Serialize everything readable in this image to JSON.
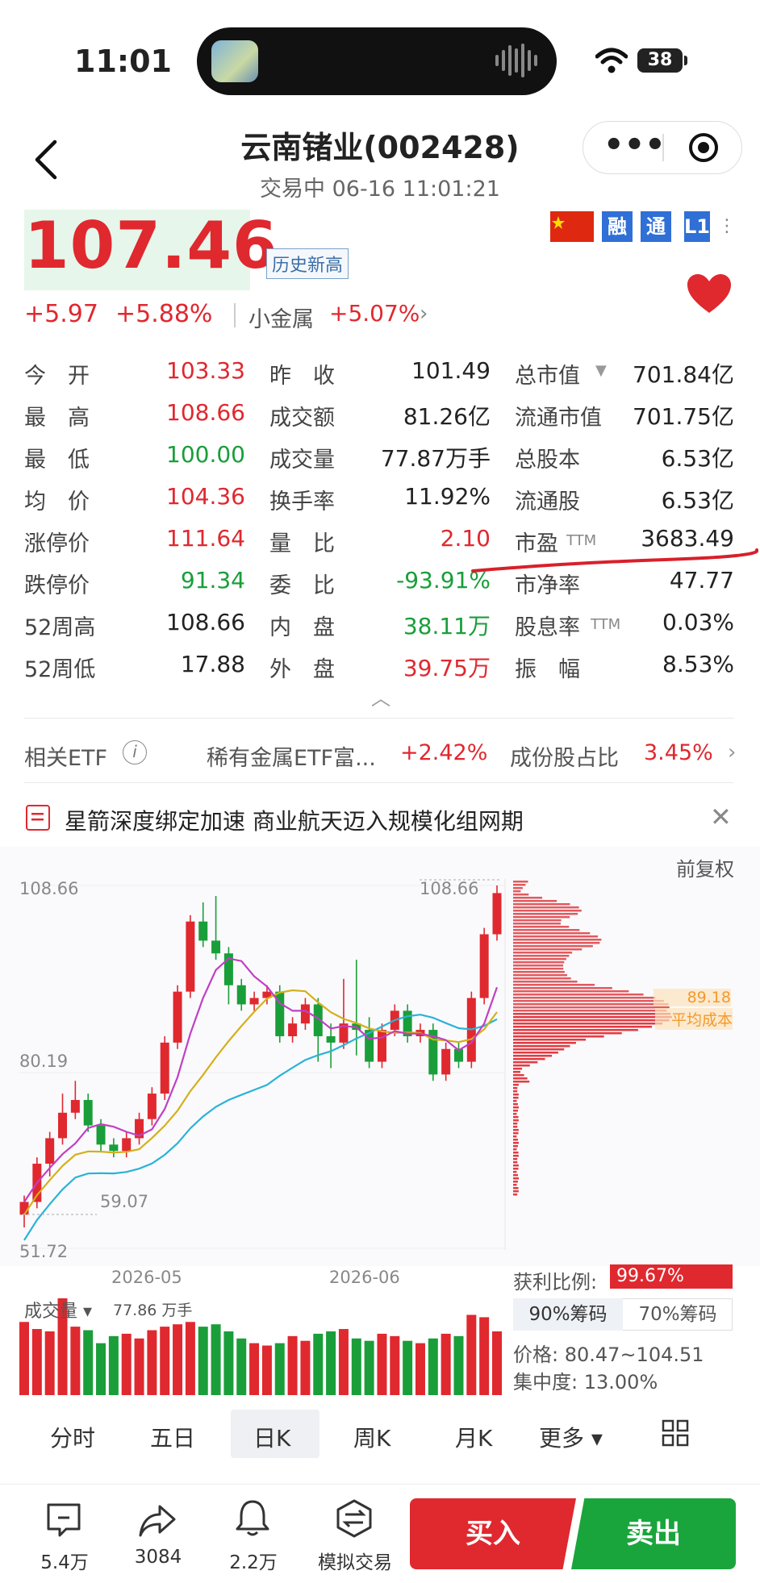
{
  "status_bar": {
    "time": "11:01",
    "battery": "38"
  },
  "header": {
    "title": "云南锗业(002428)",
    "subtitle": "交易中  06-16 11:01:21",
    "more_icon": "more-dots-icon",
    "target_icon": "target-icon"
  },
  "price": {
    "last": "107.46",
    "badge": "历史新高",
    "change": "+5.97",
    "change_pct": "+5.88%",
    "sector": "小金属",
    "sector_pct": "+5.07%",
    "tags": [
      "融",
      "通",
      "L1"
    ]
  },
  "quote": {
    "rows": [
      {
        "l1": "今　开",
        "v1": "103.33",
        "l2": "昨　收",
        "v2": "101.49",
        "l3": "总市值",
        "v3": "701.84亿"
      },
      {
        "l1": "最　高",
        "v1": "108.66",
        "l2": "成交额",
        "v2": "81.26亿",
        "l3": "流通市值",
        "v3": "701.75亿"
      },
      {
        "l1": "最　低",
        "v1": "100.00",
        "l2": "成交量",
        "v2": "77.87万手",
        "l3": "总股本",
        "v3": "6.53亿"
      },
      {
        "l1": "均　价",
        "v1": "104.36",
        "l2": "换手率",
        "v2": "11.92%",
        "l3": "流通股",
        "v3": "6.53亿"
      },
      {
        "l1": "涨停价",
        "v1": "111.64",
        "l2": "量　比",
        "v2": "2.10",
        "l3": "市盈",
        "v3": "3683.49"
      },
      {
        "l1": "跌停价",
        "v1": "91.34",
        "l2": "委　比",
        "v2": "-93.91%",
        "l3": "市净率",
        "v3": "47.77"
      },
      {
        "l1": "52周高",
        "v1": "108.66",
        "l2": "内　盘",
        "v2": "38.11万",
        "l3": "股息率",
        "v3": "0.03%"
      },
      {
        "l1": "52周低",
        "v1": "17.88",
        "l2": "外　盘",
        "v2": "39.75万",
        "l3": "振　幅",
        "v3": "8.53%"
      }
    ],
    "ttm": "TTM"
  },
  "etf": {
    "label": "相关ETF",
    "name": "稀有金属ETF富...",
    "pct": "+2.42%",
    "weight_label": "成份股占比",
    "weight": "3.45%"
  },
  "news": {
    "text": "星箭深度绑定加速 商业航天迈入规模化组网期"
  },
  "chart": {
    "adjust": "前复权",
    "y_top": "108.66",
    "y_top_right": "108.66",
    "y_mid": "80.19",
    "low_marker": "59.07",
    "y_bottom": "51.72",
    "x_labels": [
      "2026-05",
      "2026-06"
    ],
    "avg_cost_price": "89.18",
    "avg_cost_label": "平均成本"
  },
  "chart_data": {
    "type": "candlestick",
    "colors": {
      "up": "#e0282f",
      "down": "#1a9e3a",
      "ma5": "#c23fc2",
      "ma10": "#d4b01a",
      "ma20": "#2ab3d6"
    },
    "candles": [
      {
        "o": 57,
        "c": 59,
        "h": 60,
        "l": 55
      },
      {
        "o": 59,
        "c": 65,
        "h": 66,
        "l": 58
      },
      {
        "o": 65,
        "c": 69,
        "h": 70,
        "l": 63
      },
      {
        "o": 69,
        "c": 73,
        "h": 76,
        "l": 68
      },
      {
        "o": 73,
        "c": 75,
        "h": 78,
        "l": 72
      },
      {
        "o": 75,
        "c": 71,
        "h": 76,
        "l": 70
      },
      {
        "o": 71,
        "c": 68,
        "h": 72,
        "l": 67
      },
      {
        "o": 68,
        "c": 67,
        "h": 69,
        "l": 66
      },
      {
        "o": 67,
        "c": 69,
        "h": 70,
        "l": 66
      },
      {
        "o": 69,
        "c": 72,
        "h": 73,
        "l": 68
      },
      {
        "o": 72,
        "c": 76,
        "h": 77,
        "l": 71
      },
      {
        "o": 76,
        "c": 84,
        "h": 85,
        "l": 75
      },
      {
        "o": 84,
        "c": 92,
        "h": 93,
        "l": 83
      },
      {
        "o": 92,
        "c": 103,
        "h": 104,
        "l": 91
      },
      {
        "o": 103,
        "c": 100,
        "h": 106,
        "l": 99
      },
      {
        "o": 100,
        "c": 98,
        "h": 107,
        "l": 97
      },
      {
        "o": 98,
        "c": 93,
        "h": 99,
        "l": 90
      },
      {
        "o": 93,
        "c": 90,
        "h": 94,
        "l": 89
      },
      {
        "o": 90,
        "c": 91,
        "h": 92,
        "l": 89
      },
      {
        "o": 91,
        "c": 92,
        "h": 93,
        "l": 90
      },
      {
        "o": 92,
        "c": 85,
        "h": 93,
        "l": 84
      },
      {
        "o": 85,
        "c": 87,
        "h": 88,
        "l": 84
      },
      {
        "o": 87,
        "c": 90,
        "h": 91,
        "l": 86
      },
      {
        "o": 90,
        "c": 85,
        "h": 91,
        "l": 81
      },
      {
        "o": 85,
        "c": 84,
        "h": 87,
        "l": 80
      },
      {
        "o": 84,
        "c": 87,
        "h": 94,
        "l": 83
      },
      {
        "o": 87,
        "c": 86,
        "h": 97,
        "l": 82
      },
      {
        "o": 86,
        "c": 81,
        "h": 88,
        "l": 80
      },
      {
        "o": 81,
        "c": 86,
        "h": 87,
        "l": 80
      },
      {
        "o": 86,
        "c": 89,
        "h": 90,
        "l": 85
      },
      {
        "o": 89,
        "c": 85,
        "h": 90,
        "l": 84
      },
      {
        "o": 85,
        "c": 86,
        "h": 87,
        "l": 84
      },
      {
        "o": 86,
        "c": 79,
        "h": 87,
        "l": 78
      },
      {
        "o": 79,
        "c": 83,
        "h": 84,
        "l": 78
      },
      {
        "o": 83,
        "c": 81,
        "h": 84,
        "l": 80
      },
      {
        "o": 81,
        "c": 91,
        "h": 92,
        "l": 80
      },
      {
        "o": 91,
        "c": 101,
        "h": 102,
        "l": 90
      },
      {
        "o": 101,
        "c": 107.46,
        "h": 108.66,
        "l": 100
      }
    ],
    "volume": [
      62,
      56,
      54,
      82,
      58,
      55,
      44,
      50,
      52,
      48,
      55,
      58,
      60,
      62,
      58,
      60,
      54,
      48,
      44,
      42,
      44,
      50,
      46,
      52,
      54,
      56,
      48,
      46,
      52,
      50,
      46,
      44,
      48,
      52,
      50,
      68,
      66,
      54
    ]
  },
  "chips": {
    "profit_label": "获利比例:",
    "profit_value": "99.67%",
    "tab_90": "90%筹码",
    "tab_70": "70%筹码",
    "price_label": "价格:",
    "price_range": "80.47~104.51",
    "conc_label": "集中度:",
    "conc_value": "13.00%"
  },
  "volume_panel": {
    "label": "成交量 ▾",
    "value": "77.86 万手"
  },
  "period_tabs": [
    "分时",
    "五日",
    "日K",
    "周K",
    "月K",
    "更多 ▾"
  ],
  "bottom": {
    "comments": "5.4万",
    "shares": "3084",
    "alerts": "2.2万",
    "sim": "模拟交易",
    "buy": "买入",
    "sell": "卖出"
  }
}
